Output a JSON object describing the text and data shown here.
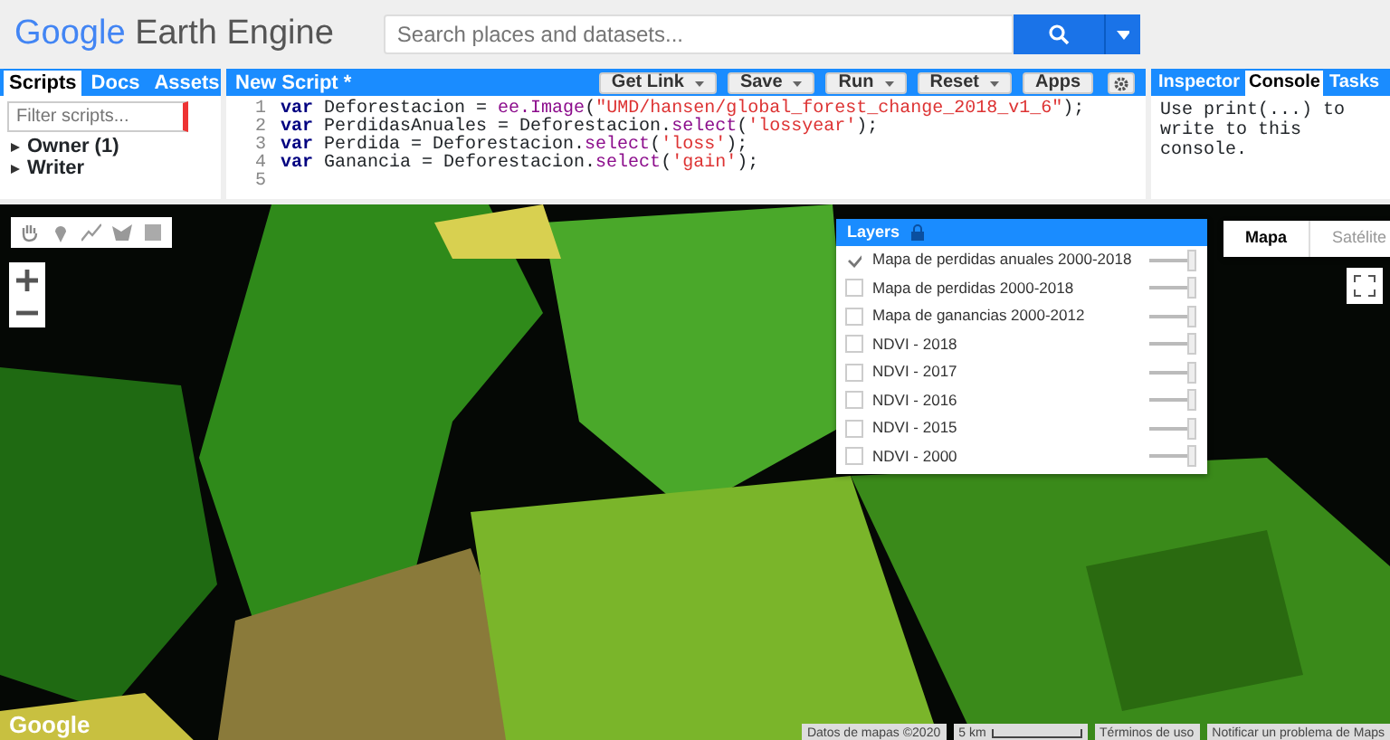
{
  "header": {
    "logo_brand": "Google",
    "logo_product": "Earth Engine",
    "search": {
      "placeholder": "Search places and datasets..."
    }
  },
  "left_panel": {
    "tabs": [
      {
        "label": "Scripts",
        "selected": true
      },
      {
        "label": "Docs",
        "selected": false
      },
      {
        "label": "Assets",
        "selected": false
      }
    ],
    "filter": {
      "placeholder": "Filter scripts..."
    },
    "tree": [
      {
        "label": "Owner (1)",
        "expanded": false
      },
      {
        "label": "Writer",
        "expanded": false
      }
    ]
  },
  "editor": {
    "title": "New Script *",
    "buttons": [
      {
        "label": "Get Link",
        "dropdown": true
      },
      {
        "label": "Save",
        "dropdown": true
      },
      {
        "label": "Run",
        "dropdown": true
      },
      {
        "label": "Reset",
        "dropdown": true
      },
      {
        "label": "Apps",
        "dropdown": false
      }
    ],
    "lines": [
      {
        "number": "1",
        "tokens": [
          {
            "kind": "keyword",
            "text": "var"
          },
          {
            "kind": "plain",
            "text": " Deforestacion = "
          },
          {
            "kind": "method",
            "text": "ee.Image"
          },
          {
            "kind": "plain",
            "text": "("
          },
          {
            "kind": "string",
            "text": "\"UMD/hansen/global_forest_change_2018_v1_6\""
          },
          {
            "kind": "plain",
            "text": ");"
          }
        ]
      },
      {
        "number": "2",
        "tokens": [
          {
            "kind": "keyword",
            "text": "var"
          },
          {
            "kind": "plain",
            "text": " PerdidasAnuales = Deforestacion."
          },
          {
            "kind": "method",
            "text": "select"
          },
          {
            "kind": "plain",
            "text": "("
          },
          {
            "kind": "string",
            "text": "'lossyear'"
          },
          {
            "kind": "plain",
            "text": ");"
          }
        ]
      },
      {
        "number": "3",
        "tokens": [
          {
            "kind": "keyword",
            "text": "var"
          },
          {
            "kind": "plain",
            "text": " Perdida = Deforestacion."
          },
          {
            "kind": "method",
            "text": "select"
          },
          {
            "kind": "plain",
            "text": "("
          },
          {
            "kind": "string",
            "text": "'loss'"
          },
          {
            "kind": "plain",
            "text": ");"
          }
        ]
      },
      {
        "number": "4",
        "tokens": [
          {
            "kind": "keyword",
            "text": "var"
          },
          {
            "kind": "plain",
            "text": " Ganancia = Deforestacion."
          },
          {
            "kind": "method",
            "text": "select"
          },
          {
            "kind": "plain",
            "text": "("
          },
          {
            "kind": "string",
            "text": "'gain'"
          },
          {
            "kind": "plain",
            "text": ");"
          }
        ]
      },
      {
        "number": "5"
      }
    ]
  },
  "right_panel": {
    "tabs": [
      {
        "label": "Inspector",
        "selected": false
      },
      {
        "label": "Console",
        "selected": true
      },
      {
        "label": "Tasks",
        "selected": false
      }
    ],
    "console_text": "Use print(...) to write to this console."
  },
  "map": {
    "layers_title": "Layers",
    "layers": [
      {
        "name": "Mapa de perdidas anuales 2000-2018",
        "checked": true,
        "level": 1
      },
      {
        "name": "Mapa de perdidas 2000-2018",
        "checked": false,
        "level": 1
      },
      {
        "name": "Mapa de ganancias 2000-2012",
        "checked": false,
        "level": 1
      },
      {
        "name": "NDVI - 2018",
        "checked": false,
        "level": 1
      },
      {
        "name": "NDVI - 2017",
        "checked": false,
        "level": 1
      },
      {
        "name": "NDVI - 2016",
        "checked": false,
        "level": 1
      },
      {
        "name": "NDVI - 2015",
        "checked": false,
        "level": 1
      },
      {
        "name": "NDVI - 2000",
        "checked": false,
        "level": 1
      }
    ],
    "map_types": [
      {
        "label": "Mapa",
        "selected": true
      },
      {
        "label": "Satélite",
        "selected": false
      }
    ],
    "footer": {
      "logo": "Google",
      "data": "Datos de mapas ©2020",
      "scale": "5 km",
      "terms": "Términos de uso",
      "report": "Notificar un problema de Maps"
    }
  }
}
